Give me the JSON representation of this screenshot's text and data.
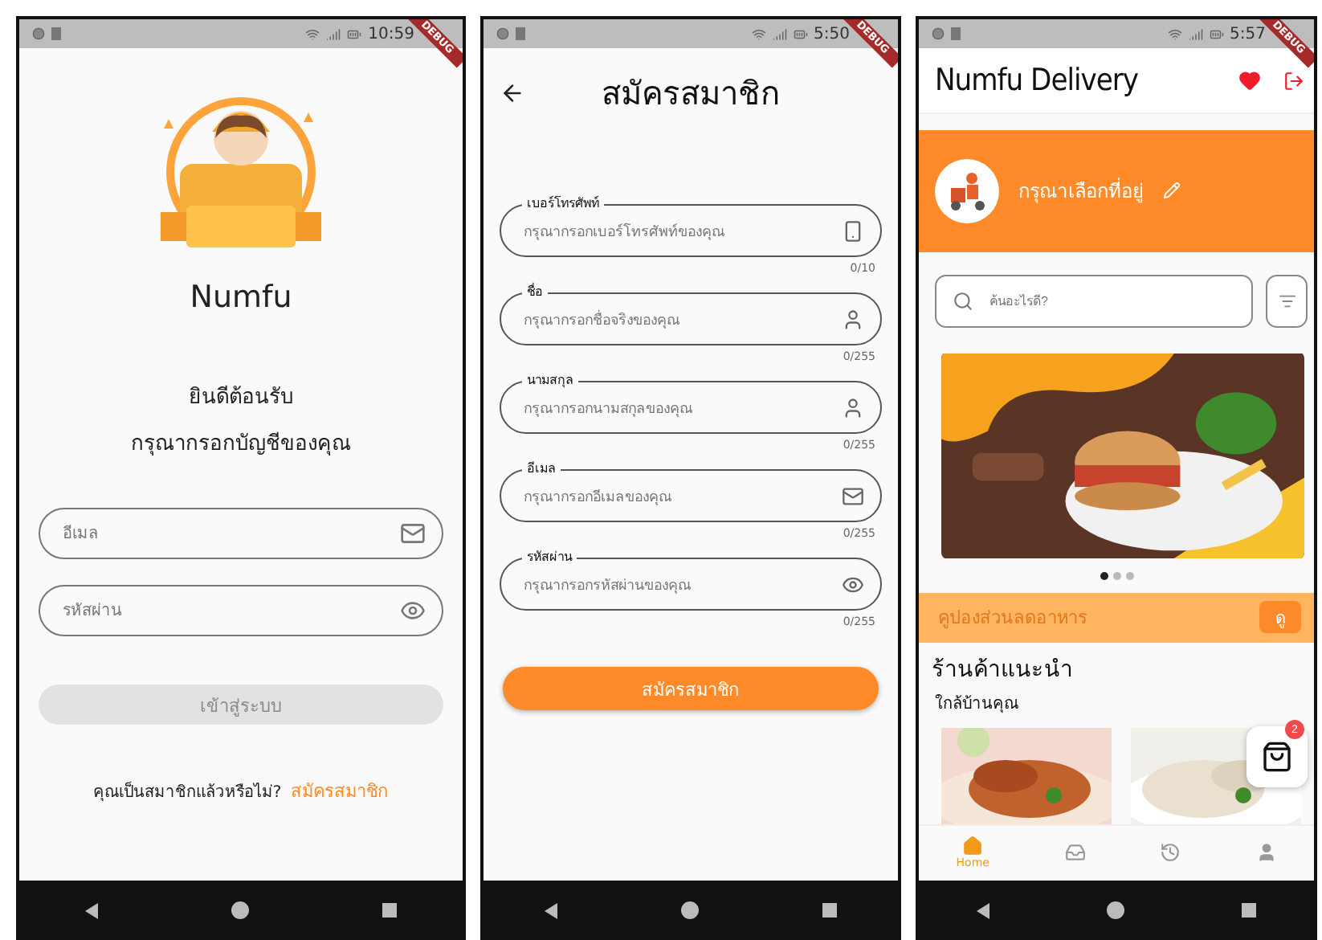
{
  "login_screen": {
    "status_bar": {
      "time": "10:59"
    },
    "debug_banner": "DEBUG",
    "app_name": "Numfu",
    "welcome": "ยินดีต้อนรับ",
    "prompt": "กรุณากรอกบัญชีของคุณ",
    "fields": [
      {
        "placeholder": "อีเมล",
        "kind": "email"
      },
      {
        "placeholder": "รหัสผ่าน",
        "kind": "password"
      }
    ],
    "login_button": {
      "label": "เข้าสู่ระบบ",
      "disabled": true
    },
    "signup_prompt": "คุณเป็นสมาชิกแล้วหรือไม่?",
    "signup_link": "สมัครสมาชิก"
  },
  "register_screen": {
    "status_bar": {
      "time": "5:50"
    },
    "debug_banner": "DEBUG",
    "title": "สมัครสมาชิก",
    "fields": [
      {
        "label": "เบอร์โทรศัพท์",
        "placeholder": "กรุณากรอกเบอร์โทรศัพท์ของคุณ",
        "counter": "0/10",
        "kind": "phone"
      },
      {
        "label": "ชื่อ",
        "placeholder": "กรุณากรอกชื่อจริงของคุณ",
        "counter": "0/255",
        "kind": "person"
      },
      {
        "label": "นามสกุล",
        "placeholder": "กรุณากรอกนามสกุลของคุณ",
        "counter": "0/255",
        "kind": "person"
      },
      {
        "label": "อีเมล",
        "placeholder": "กรุณากรอกอีเมลของคุณ",
        "counter": "0/255",
        "kind": "email"
      },
      {
        "label": "รหัสผ่าน",
        "placeholder": "กรุณากรอกรหัสผ่านของคุณ",
        "counter": "0/255",
        "kind": "password"
      }
    ],
    "submit_button": "สมัครสมาชิก"
  },
  "home_screen": {
    "status_bar": {
      "time": "5:57"
    },
    "debug_banner": "DEBUG",
    "title": "Numfu Delivery",
    "location_prompt": "กรุณาเลือกที่อยู่",
    "search": {
      "placeholder": "ค้นอะไรดี?"
    },
    "carousel_dots": [
      {
        "selected": true
      },
      {
        "selected": false
      },
      {
        "selected": false
      }
    ],
    "coupon": {
      "label": "คูปองส่วนลดอาหาร",
      "button": "ดู"
    },
    "section_title": "ร้านค้าแนะนำ",
    "section_subtitle": "ใกล้บ้านคุณ",
    "cart": {
      "badge": "2"
    },
    "nav": [
      {
        "kind": "home",
        "label": "Home",
        "selected": true
      },
      {
        "kind": "orders",
        "selected": false
      },
      {
        "kind": "history",
        "selected": false
      },
      {
        "kind": "profile",
        "selected": false
      }
    ]
  }
}
